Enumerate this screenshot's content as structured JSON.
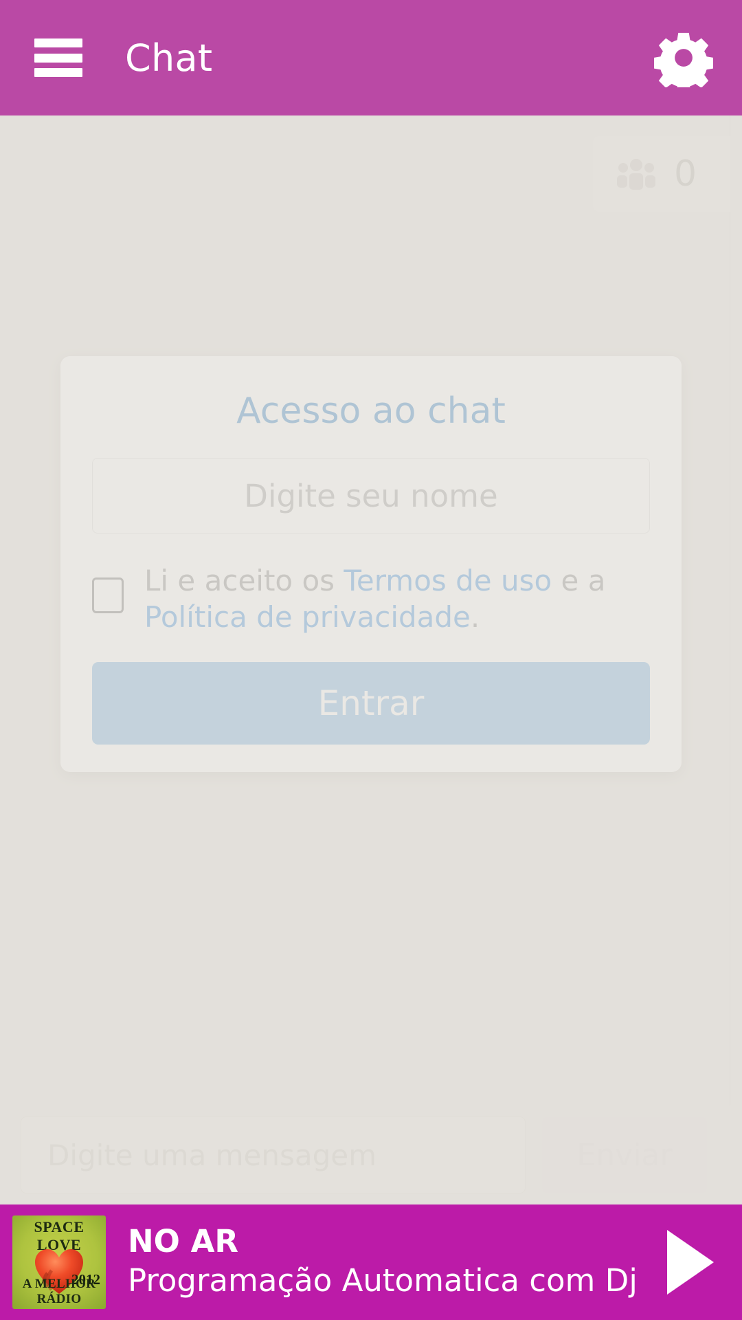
{
  "header": {
    "title": "Chat",
    "menu_icon": "hamburger-menu-icon",
    "settings_icon": "gear-icon",
    "background_color": "#ba49a5"
  },
  "chat": {
    "users_badge": {
      "icon": "users-group-icon",
      "count": "0"
    },
    "composer": {
      "placeholder": "Digite uma mensagem",
      "send_label": "Enviar"
    }
  },
  "modal": {
    "title": "Acesso ao chat",
    "name_input": {
      "value": "",
      "placeholder": "Digite seu nome"
    },
    "terms": {
      "checked": false,
      "prefix": "Li e aceito os ",
      "link_terms": "Termos de uso",
      "middle": " e a ",
      "link_privacy": "Política de privacidade",
      "suffix": "."
    },
    "submit_label": "Entrar",
    "accent_color": "#2b7fc4",
    "button_color": "#76b0e2",
    "link_color": "#3d90dd"
  },
  "player": {
    "cover": {
      "title": "SPACE LOVE",
      "year": "2012",
      "tagline": "A MELHOR RÁDIO",
      "art_icon": "heart-waves-icon"
    },
    "status": "NO AR",
    "track": "Programação Automatica com Dj A...",
    "play_icon": "play-icon",
    "background_color": "#bc1ba8"
  }
}
